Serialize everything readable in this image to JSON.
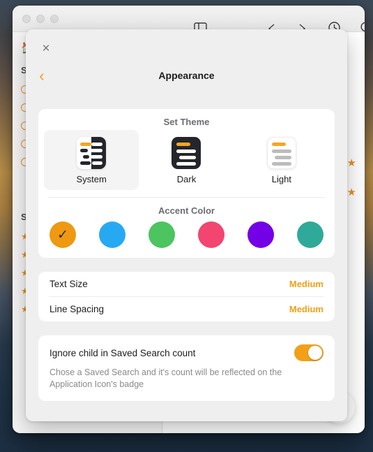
{
  "window": {
    "traffic_lights": [
      "close",
      "minimize",
      "zoom"
    ],
    "toolbar_icons": [
      "sidebar-toggle-icon",
      "chevron-left-icon",
      "chevron-right-icon",
      "history-icon",
      "search-icon"
    ],
    "sidebar": {
      "home_icon": "home-icon",
      "sections": [
        {
          "title": "S",
          "items": [
            "",
            "",
            "",
            "",
            ""
          ]
        },
        {
          "title": "S",
          "items": [
            "",
            "",
            "",
            "",
            ""
          ]
        }
      ]
    },
    "right_markers": [
      "star",
      "star"
    ],
    "fab_label": "+"
  },
  "modal": {
    "close_label": "×",
    "back_label": "‹",
    "title": "Appearance",
    "theme": {
      "group_title": "Set Theme",
      "selected": "System",
      "options": [
        {
          "label": "System",
          "icon": "theme-system-icon",
          "selected": true
        },
        {
          "label": "Dark",
          "icon": "theme-dark-icon",
          "selected": false
        },
        {
          "label": "Light",
          "icon": "theme-light-icon",
          "selected": false
        }
      ]
    },
    "accent": {
      "group_title": "Accent Color",
      "check_glyph": "✓",
      "selected_index": 0,
      "colors": [
        {
          "name": "orange",
          "hex": "#ee9911",
          "selected": true
        },
        {
          "name": "blue",
          "hex": "#27a9f2",
          "selected": false
        },
        {
          "name": "green",
          "hex": "#4cc45f",
          "selected": false
        },
        {
          "name": "pink",
          "hex": "#f2456f",
          "selected": false
        },
        {
          "name": "purple",
          "hex": "#7300e6",
          "selected": false
        },
        {
          "name": "teal",
          "hex": "#2fa99a",
          "selected": false
        }
      ]
    },
    "settings_rows": [
      {
        "label": "Text Size",
        "value": "Medium"
      },
      {
        "label": "Line Spacing",
        "value": "Medium"
      }
    ],
    "toggle": {
      "title": "Ignore child in Saved Search count",
      "description": "Chose a Saved Search and it's count will be reflected on the Application Icon's badge",
      "state": "on",
      "on_color": "#f2a018"
    }
  }
}
